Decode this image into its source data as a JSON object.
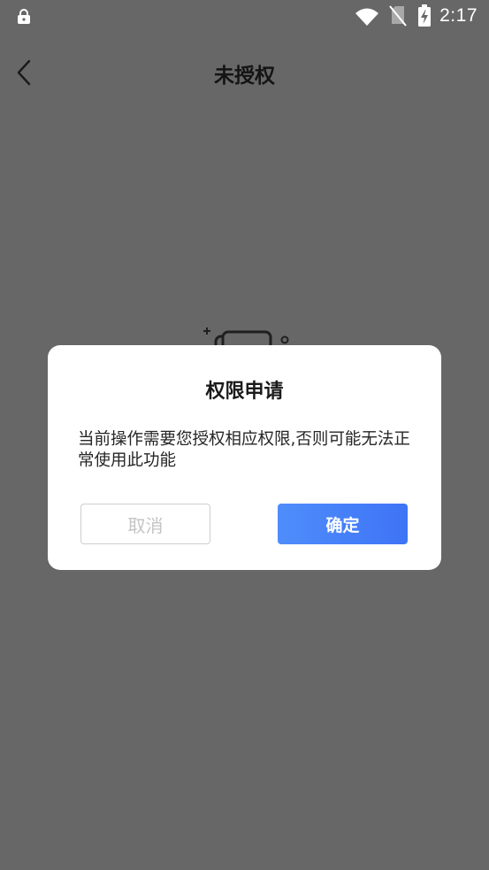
{
  "status_bar": {
    "time": "2:17",
    "icons": [
      "lock-icon",
      "wifi-icon",
      "no-sim-icon",
      "battery-charging-icon"
    ]
  },
  "header": {
    "back_icon": "chevron-left-icon",
    "title": "未授权"
  },
  "empty_state": {
    "icon": "empty-cards-illustration"
  },
  "dialog": {
    "title": "权限申请",
    "message": "当前操作需要您授权相应权限,否则可能无法正常使用此功能",
    "cancel_label": "取消",
    "confirm_label": "确定"
  },
  "colors": {
    "overlay_background": "#676767",
    "dialog_background": "#ffffff",
    "confirm_gradient_start": "#4f8dfb",
    "confirm_gradient_end": "#3e74f6",
    "cancel_text": "#c4c4c4"
  }
}
